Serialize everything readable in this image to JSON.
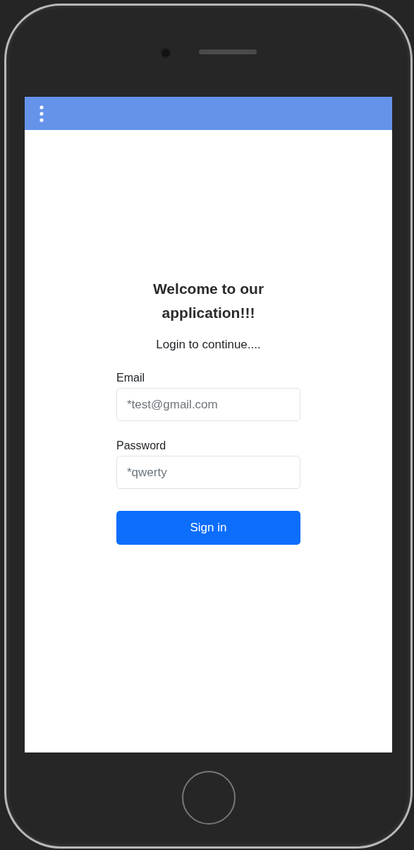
{
  "title": "Welcome to our application!!!",
  "subtitle": "Login to continue....",
  "fields": [
    {
      "label": "Email",
      "placeholder": "*test@gmail.com"
    },
    {
      "label": "Password",
      "placeholder": "*qwerty"
    }
  ],
  "button": "Sign in"
}
